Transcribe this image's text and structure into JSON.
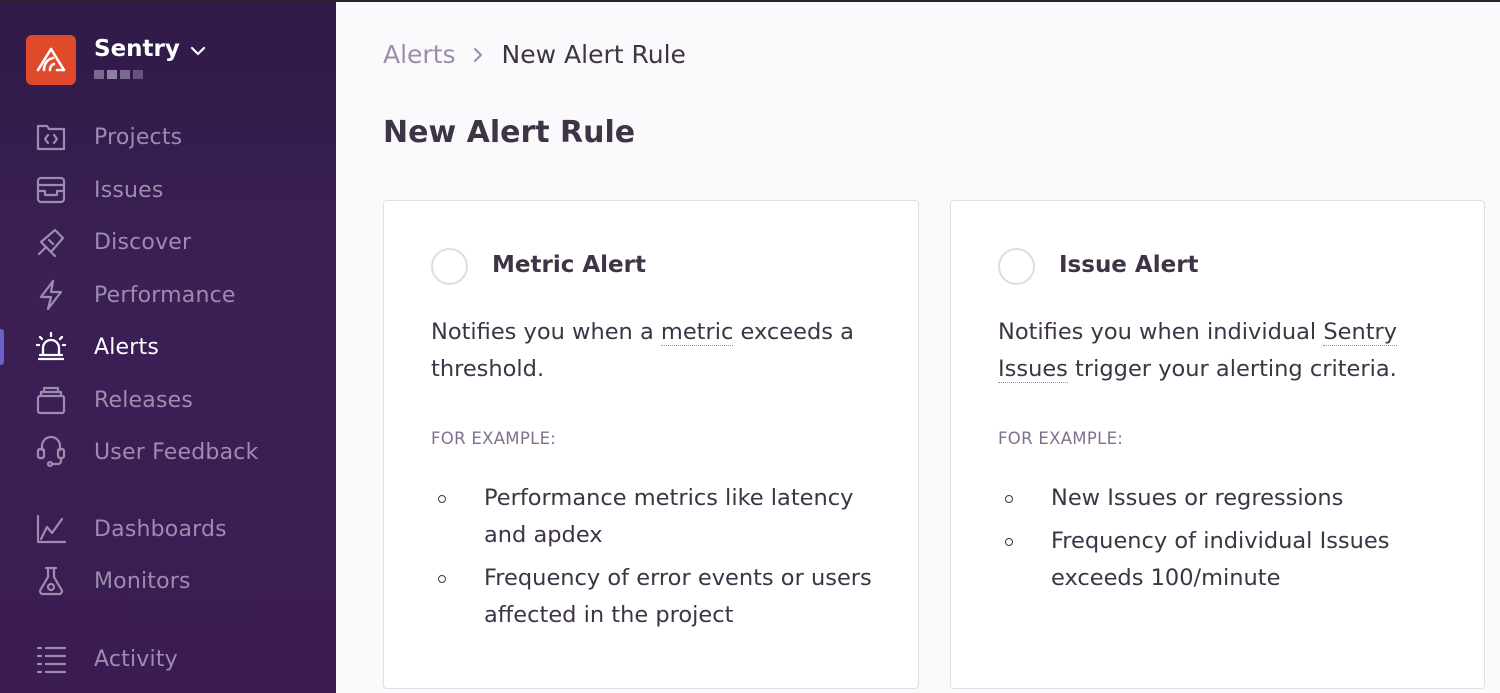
{
  "org": {
    "name": "Sentry"
  },
  "sidebar": {
    "items": [
      {
        "label": "Projects",
        "icon": "projects-icon"
      },
      {
        "label": "Issues",
        "icon": "issues-icon"
      },
      {
        "label": "Discover",
        "icon": "discover-icon"
      },
      {
        "label": "Performance",
        "icon": "performance-icon"
      },
      {
        "label": "Alerts",
        "icon": "alerts-icon",
        "active": true
      },
      {
        "label": "Releases",
        "icon": "releases-icon"
      },
      {
        "label": "User Feedback",
        "icon": "user-feedback-icon"
      },
      {
        "label": "Dashboards",
        "icon": "dashboards-icon"
      },
      {
        "label": "Monitors",
        "icon": "monitors-icon"
      },
      {
        "label": "Activity",
        "icon": "activity-icon"
      }
    ]
  },
  "breadcrumb": {
    "parent": "Alerts",
    "current": "New Alert Rule"
  },
  "page": {
    "title": "New Alert Rule"
  },
  "cards": {
    "metric": {
      "title": "Metric Alert",
      "desc_before": "Notifies you when a ",
      "desc_term": "metric",
      "desc_after": " exceeds a threshold.",
      "example_label": "FOR EXAMPLE:",
      "examples": [
        "Performance metrics like latency and apdex",
        "Frequency of error events or users affected in the project"
      ]
    },
    "issue": {
      "title": "Issue Alert",
      "desc_before": "Notifies you when individual ",
      "desc_term": "Sentry Issues",
      "desc_after": " trigger your alerting criteria.",
      "example_label": "FOR EXAMPLE:",
      "examples": [
        "New Issues or regressions",
        "Frequency of individual Issues exceeds 100/minute"
      ]
    }
  },
  "colors": {
    "accent": "#6c5fc7",
    "brand": "#e1492b",
    "sidebar_bg": "#3b1f55"
  }
}
